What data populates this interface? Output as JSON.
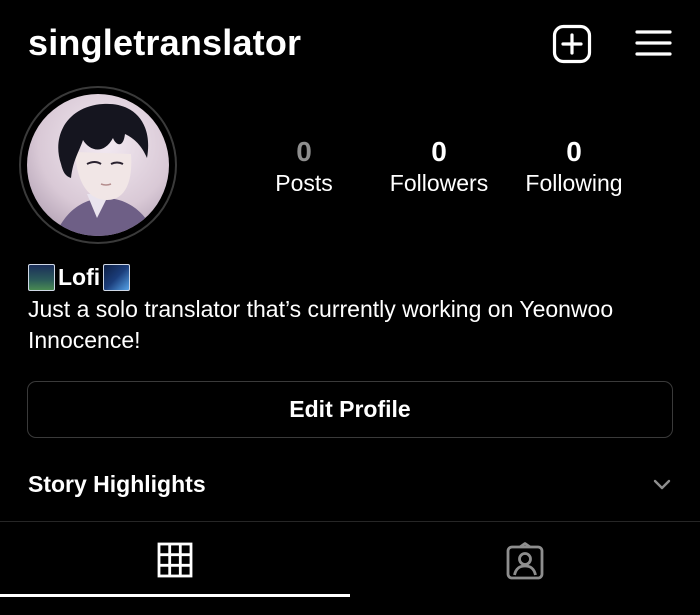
{
  "header": {
    "username": "singletranslator",
    "new_post_icon": "plus-square-icon",
    "menu_icon": "hamburger-menu-icon"
  },
  "profile": {
    "avatar": "profile-avatar",
    "stats": [
      {
        "value": "0",
        "label": "Posts"
      },
      {
        "value": "0",
        "label": "Followers"
      },
      {
        "value": "0",
        "label": "Following"
      }
    ],
    "display_name": "Lofi",
    "bio": "Just a solo translator that’s currently working on Yeonwoo Innocence!"
  },
  "actions": {
    "edit_profile": "Edit Profile"
  },
  "highlights": {
    "title": "Story Highlights",
    "icon": "chevron-down-icon"
  },
  "tabs": [
    {
      "icon": "grid-icon",
      "active": true
    },
    {
      "icon": "tagged-person-icon",
      "active": false
    }
  ],
  "colors": {
    "background": "#000000",
    "text": "#ffffff",
    "muted": "#8e8e8e",
    "border": "#3a3a3a"
  }
}
